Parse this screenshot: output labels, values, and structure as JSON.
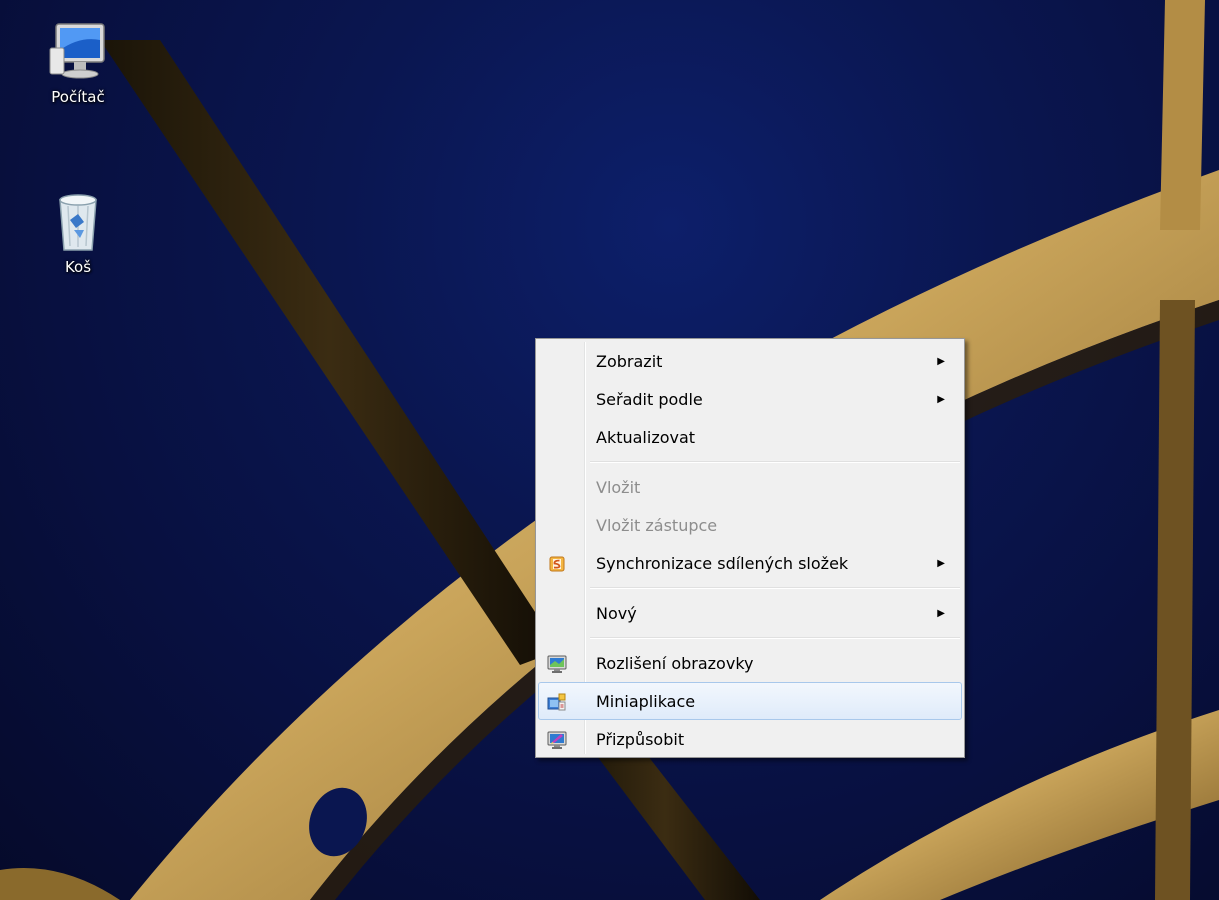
{
  "desktop": {
    "icons": [
      {
        "label": "Počítač",
        "icon": "computer-icon"
      },
      {
        "label": "Koš",
        "icon": "recycle-bin-icon"
      }
    ]
  },
  "context_menu": {
    "items": [
      {
        "label": "Zobrazit",
        "submenu": true,
        "disabled": false
      },
      {
        "label": "Seřadit podle",
        "submenu": true,
        "disabled": false
      },
      {
        "label": "Aktualizovat",
        "submenu": false,
        "disabled": false
      },
      {
        "label": "Vložit",
        "submenu": false,
        "disabled": true
      },
      {
        "label": "Vložit zástupce",
        "submenu": false,
        "disabled": true
      },
      {
        "label": "Synchronizace sdílených složek",
        "submenu": true,
        "disabled": false,
        "icon": "sync-shared-folders-icon"
      },
      {
        "label": "Nový",
        "submenu": true,
        "disabled": false
      },
      {
        "label": "Rozlišení obrazovky",
        "submenu": false,
        "disabled": false,
        "icon": "screen-resolution-icon"
      },
      {
        "label": "Miniaplikace",
        "submenu": false,
        "disabled": false,
        "icon": "gadgets-icon",
        "highlighted": true
      },
      {
        "label": "Přizpůsobit",
        "submenu": false,
        "disabled": false,
        "icon": "personalize-icon"
      }
    ],
    "submenu_arrow": "▶"
  },
  "colors": {
    "wallpaper_blue": "#0a1650",
    "arch_gold": "#c9a45a",
    "menu_bg": "#f0f0f0",
    "highlight_border": "#a8c8eb",
    "disabled_text": "#8d8d8d"
  }
}
